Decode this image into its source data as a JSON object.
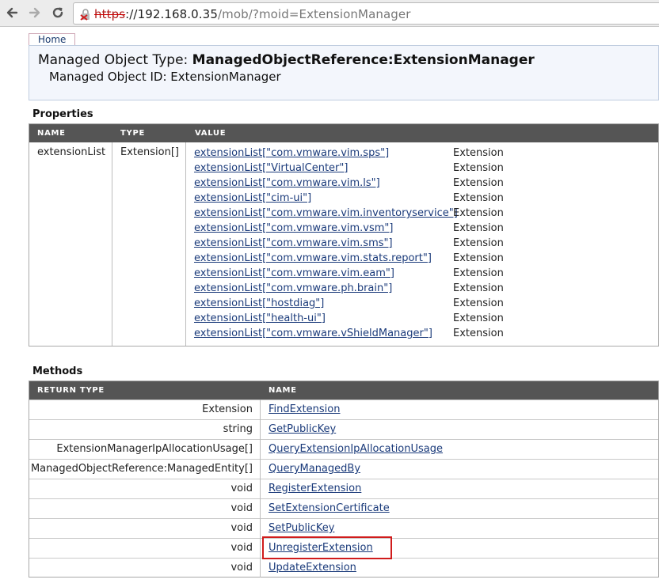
{
  "browser": {
    "url_scheme": "https",
    "url_host": "://192.168.0.35",
    "url_path": "/mob/?moid=ExtensionManager"
  },
  "page": {
    "home_tab": "Home",
    "mot_label": "Managed Object Type: ",
    "mot_value": "ManagedObjectReference:ExtensionManager",
    "moid_label": "Managed Object ID: ",
    "moid_value": "ExtensionManager"
  },
  "properties": {
    "title": "Properties",
    "headers": [
      "NAME",
      "TYPE",
      "VALUE"
    ],
    "row": {
      "name": "extensionList",
      "type": "Extension[]",
      "values": [
        {
          "link": "extensionList[\"com.vmware.vim.sps\"]",
          "type": "Extension"
        },
        {
          "link": "extensionList[\"VirtualCenter\"]",
          "type": "Extension"
        },
        {
          "link": "extensionList[\"com.vmware.vim.ls\"]",
          "type": "Extension"
        },
        {
          "link": "extensionList[\"cim-ui\"]",
          "type": "Extension"
        },
        {
          "link": "extensionList[\"com.vmware.vim.inventoryservice\"]",
          "type": "Extension"
        },
        {
          "link": "extensionList[\"com.vmware.vim.vsm\"]",
          "type": "Extension"
        },
        {
          "link": "extensionList[\"com.vmware.vim.sms\"]",
          "type": "Extension"
        },
        {
          "link": "extensionList[\"com.vmware.vim.stats.report\"]",
          "type": "Extension"
        },
        {
          "link": "extensionList[\"com.vmware.vim.eam\"]",
          "type": "Extension"
        },
        {
          "link": "extensionList[\"com.vmware.ph.brain\"]",
          "type": "Extension"
        },
        {
          "link": "extensionList[\"hostdiag\"]",
          "type": "Extension"
        },
        {
          "link": "extensionList[\"health-ui\"]",
          "type": "Extension"
        },
        {
          "link": "extensionList[\"com.vmware.vShieldManager\"]",
          "type": "Extension"
        }
      ]
    }
  },
  "methods": {
    "title": "Methods",
    "headers": [
      "RETURN TYPE",
      "NAME"
    ],
    "rows": [
      {
        "return_type": "Extension",
        "name": "FindExtension"
      },
      {
        "return_type": "string",
        "name": "GetPublicKey"
      },
      {
        "return_type": "ExtensionManagerIpAllocationUsage[]",
        "name": "QueryExtensionIpAllocationUsage"
      },
      {
        "return_type": "ManagedObjectReference:ManagedEntity[]",
        "name": "QueryManagedBy"
      },
      {
        "return_type": "void",
        "name": "RegisterExtension"
      },
      {
        "return_type": "void",
        "name": "SetExtensionCertificate"
      },
      {
        "return_type": "void",
        "name": "SetPublicKey"
      },
      {
        "return_type": "void",
        "name": "UnregisterExtension"
      },
      {
        "return_type": "void",
        "name": "UpdateExtension"
      }
    ]
  },
  "colors": {
    "header_bar": "#555555",
    "link": "#1a3a7a",
    "highlight": "#d01c1c"
  }
}
